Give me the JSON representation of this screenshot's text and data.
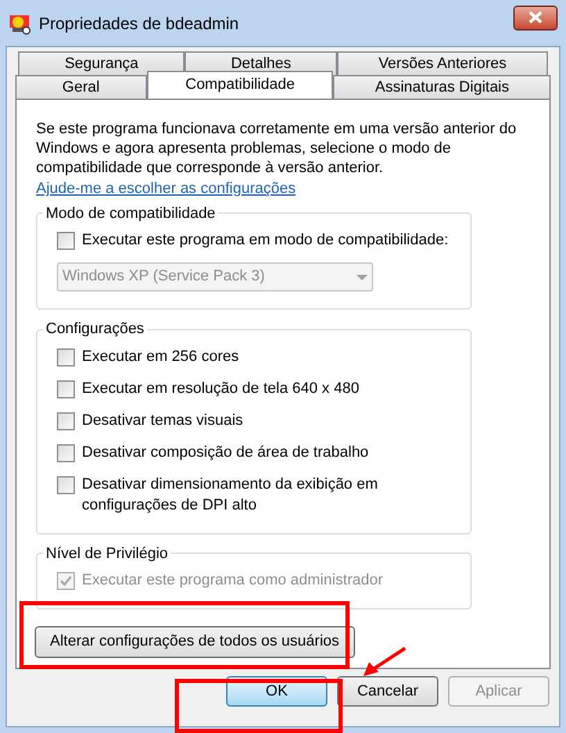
{
  "window": {
    "title": "Propriedades de bdeadmin"
  },
  "tab_rows": [
    [
      {
        "label": "Segurança",
        "selected": false
      },
      {
        "label": "Detalhes",
        "selected": false
      },
      {
        "label": "Versões Anteriores",
        "selected": false
      }
    ],
    [
      {
        "label": "Geral",
        "selected": false
      },
      {
        "label": "Compatibilidade",
        "selected": true
      },
      {
        "label": "Assinaturas Digitais",
        "selected": false
      }
    ]
  ],
  "intro": "Se este programa funcionava corretamente em uma versão anterior do Windows e agora apresenta problemas, selecione o modo de compatibilidade que corresponde à versão anterior.",
  "help_link": "Ajude-me a escolher as configurações",
  "groups": [
    {
      "title": "Modo de compatibilidade",
      "items": [
        {
          "kind": "checkbox",
          "label": "Executar este programa em modo de compatibilidade:",
          "checked": false,
          "disabled": false
        },
        {
          "kind": "dropdown",
          "value": "Windows XP (Service Pack 3)",
          "disabled": true
        }
      ]
    },
    {
      "title": "Configurações",
      "items": [
        {
          "kind": "checkbox",
          "label": "Executar em 256 cores",
          "checked": false,
          "disabled": false
        },
        {
          "kind": "checkbox",
          "label": "Executar em resolução de tela 640 x 480",
          "checked": false,
          "disabled": false
        },
        {
          "kind": "checkbox",
          "label": "Desativar temas visuais",
          "checked": false,
          "disabled": false
        },
        {
          "kind": "checkbox",
          "label": "Desativar composição de área de trabalho",
          "checked": false,
          "disabled": false
        },
        {
          "kind": "checkbox",
          "label": "Desativar dimensionamento da exibição em configurações de DPI alto",
          "checked": false,
          "disabled": false
        }
      ]
    },
    {
      "title": "Nível de Privilégio",
      "items": [
        {
          "kind": "checkbox",
          "label": "Executar este programa como administrador",
          "checked": true,
          "disabled": true
        }
      ]
    }
  ],
  "change_all_button": "Alterar configurações de todos os usuários",
  "buttons": [
    {
      "label": "OK",
      "default": true,
      "disabled": false
    },
    {
      "label": "Cancelar",
      "default": false,
      "disabled": false
    },
    {
      "label": "Aplicar",
      "default": false,
      "disabled": true
    }
  ]
}
